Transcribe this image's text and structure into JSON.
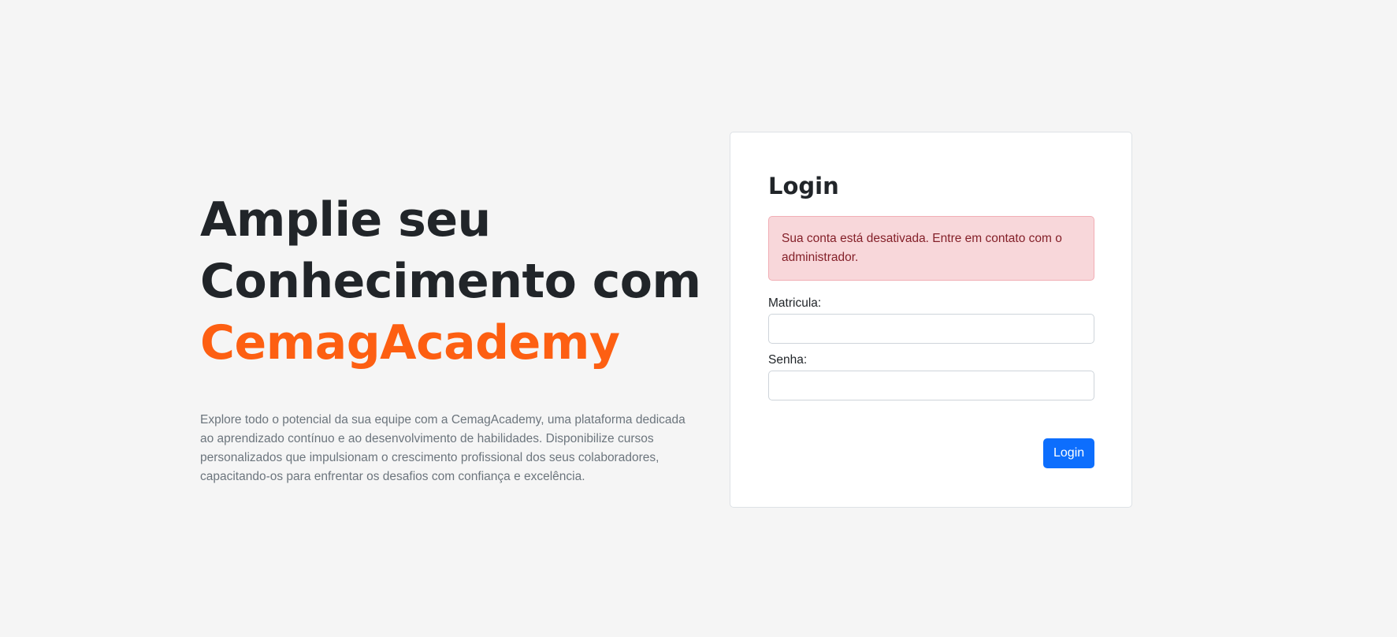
{
  "hero": {
    "title_line1": "Amplie seu",
    "title_line2": "Conhecimento com",
    "title_brand": "CemagAcademy",
    "description": "Explore todo o potencial da sua equipe com a CemagAcademy, uma plataforma dedicada ao aprendizado contínuo e ao desenvolvimento de habilidades. Disponibilize cursos personalizados que impulsionam o crescimento profissional dos seus colaboradores, capacitando-os para enfrentar os desafios com confiança e excelência."
  },
  "login": {
    "title": "Login",
    "alert": "Sua conta está desativada. Entre em contato com o administrador.",
    "matricula_label": "Matricula:",
    "matricula_value": "",
    "senha_label": "Senha:",
    "senha_value": "",
    "button_label": "Login"
  },
  "colors": {
    "background": "#f5f5f5",
    "brand_orange": "#fd5f12",
    "primary_blue": "#0d6efd",
    "alert_bg": "#f8d7da",
    "alert_text": "#842029"
  }
}
